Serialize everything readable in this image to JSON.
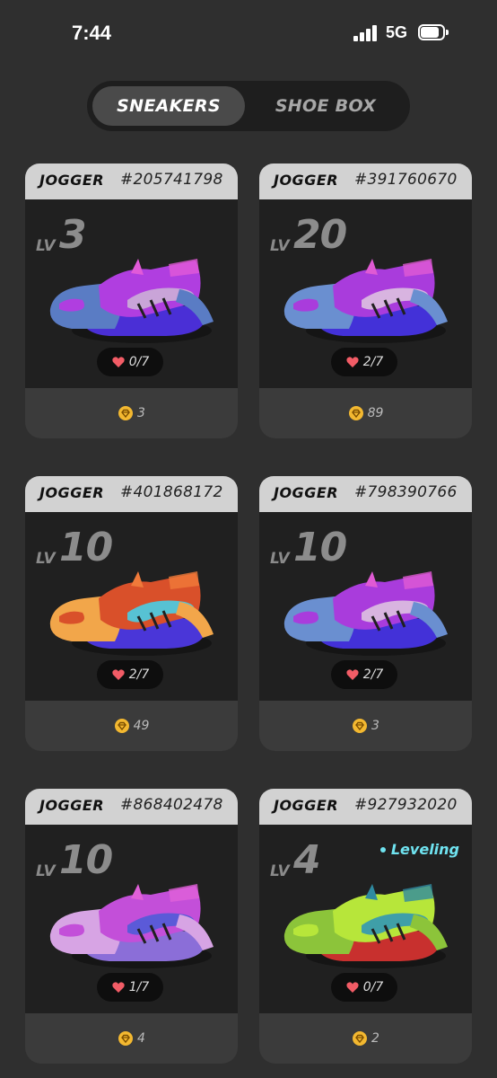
{
  "status_bar": {
    "time": "7:44",
    "network": "5G"
  },
  "tabs": [
    {
      "label": "SNEAKERS",
      "active": true
    },
    {
      "label": "SHOE BOX",
      "active": false
    }
  ],
  "cards": [
    {
      "model": "JOGGER",
      "id": "#205741798",
      "lv_label": "LV",
      "level": "3",
      "lives": "0/7",
      "mint": "3",
      "status": "",
      "colors": {
        "upper": "#b03ee0",
        "toe": "#5a7cc4",
        "sole": "#4a2fd6",
        "wing": "#c9a4d8",
        "accent": "#e25ad8"
      }
    },
    {
      "model": "JOGGER",
      "id": "#391760670",
      "lv_label": "LV",
      "level": "20",
      "lives": "2/7",
      "mint": "89",
      "status": "",
      "colors": {
        "upper": "#a93cdc",
        "toe": "#6a8fd0",
        "sole": "#4331d8",
        "wing": "#d8b4e0",
        "accent": "#e05ad4"
      }
    },
    {
      "model": "JOGGER",
      "id": "#401868172",
      "lv_label": "LV",
      "level": "10",
      "lives": "2/7",
      "mint": "49",
      "status": "",
      "colors": {
        "upper": "#d9502a",
        "toe": "#f2a64a",
        "sole": "#4a36d8",
        "wing": "#57c2d3",
        "accent": "#f07a3a"
      }
    },
    {
      "model": "JOGGER",
      "id": "#798390766",
      "lv_label": "LV",
      "level": "10",
      "lives": "2/7",
      "mint": "3",
      "status": "",
      "colors": {
        "upper": "#a93cdc",
        "toe": "#6a8fd0",
        "sole": "#4331d8",
        "wing": "#d8b4e0",
        "accent": "#e05ad4"
      }
    },
    {
      "model": "JOGGER",
      "id": "#868402478",
      "lv_label": "LV",
      "level": "10",
      "lives": "1/7",
      "mint": "4",
      "status": "",
      "colors": {
        "upper": "#c34fd9",
        "toe": "#d7a4e4",
        "sole": "#8b6ed8",
        "wing": "#5b5ad8",
        "accent": "#e060d8"
      }
    },
    {
      "model": "JOGGER",
      "id": "#927932020",
      "lv_label": "LV",
      "level": "4",
      "lives": "0/7",
      "mint": "2",
      "status": "Leveling",
      "colors": {
        "upper": "#b7e63a",
        "toe": "#8cc43a",
        "sole": "#c8302e",
        "wing": "#3f9fa8",
        "accent": "#2f8aa0"
      }
    }
  ]
}
